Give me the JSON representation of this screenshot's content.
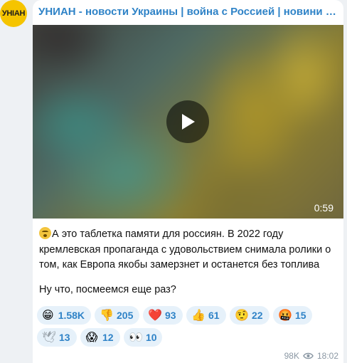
{
  "channel": {
    "avatar_text": "УНІАН",
    "name": "УНИАН - новости Украины | война с Россией | новини України | УНІАН"
  },
  "video": {
    "duration": "0:59"
  },
  "post": {
    "line1": "А это таблетка памяти для россиян. В 2022 году кремлевская пропаганда с удовольствием снимала ролики о том, как Европа якобы замерзнет и останется без топлива",
    "line2": "Ну что, посмеемся еще раз?"
  },
  "reactions": [
    {
      "emoji": "😁",
      "count": "1.58K",
      "icon": "grin-icon"
    },
    {
      "emoji": "👎",
      "count": "205",
      "icon": "thumbs-down-icon"
    },
    {
      "emoji": "❤️",
      "count": "93",
      "icon": "heart-icon"
    },
    {
      "emoji": "👍",
      "count": "61",
      "icon": "thumbs-up-icon"
    },
    {
      "emoji": "🤨",
      "count": "22",
      "icon": "raised-eyebrow-icon"
    },
    {
      "emoji": "🤬",
      "count": "15",
      "icon": "cursing-face-icon"
    },
    {
      "emoji": "🕊",
      "count": "13",
      "icon": "dove-icon"
    },
    {
      "emoji": "😱",
      "count": "12",
      "icon": "screaming-face-icon"
    },
    {
      "emoji": "👀",
      "count": "10",
      "icon": "eyes-icon"
    }
  ],
  "footer": {
    "views": "98K",
    "time": "18:02"
  }
}
